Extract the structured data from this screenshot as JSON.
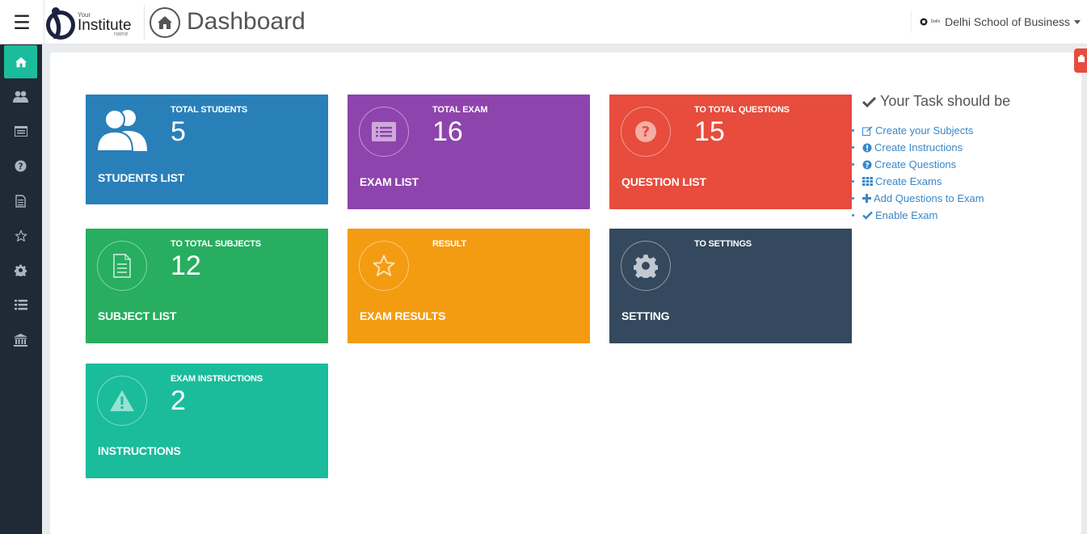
{
  "header": {
    "menu_icon": "hamburger-icon",
    "logo": {
      "your": "Your",
      "institute": "Institute",
      "name": "name"
    },
    "page_title": "Dashboard",
    "user": {
      "logo_text": "Delhi",
      "name": "Delhi School of Business"
    }
  },
  "sidebar": {
    "items": [
      {
        "icon": "home-icon",
        "active": true
      },
      {
        "icon": "users-icon"
      },
      {
        "icon": "list-alt-icon"
      },
      {
        "icon": "question-circle-icon"
      },
      {
        "icon": "file-text-icon"
      },
      {
        "icon": "star-icon"
      },
      {
        "icon": "gear-icon"
      },
      {
        "icon": "list-icon"
      },
      {
        "icon": "institution-icon"
      }
    ]
  },
  "tiles": [
    {
      "label": "TOTAL STUDENTS",
      "count": "5",
      "title": "STUDENTS LIST",
      "color": "#2980b9",
      "icon": "users-icon"
    },
    {
      "label": "TOTAL EXAM",
      "count": "16",
      "title": "EXAM LIST",
      "color": "#8e44ad",
      "icon": "list-alt-icon"
    },
    {
      "label": "TO TOTAL QUESTIONS",
      "count": "15",
      "title": "QUESTION LIST",
      "color": "#e74c3c",
      "icon": "question-circle-icon"
    },
    {
      "label": "TO TOTAL SUBJECTS",
      "count": "12",
      "title": "SUBJECT LIST",
      "color": "#27ae60",
      "icon": "file-text-icon"
    },
    {
      "label": "RESULT",
      "count": "",
      "title": "EXAM RESULTS",
      "color": "#f39c12",
      "icon": "star-icon"
    },
    {
      "label": "TO SETTINGS",
      "count": "",
      "title": "SETTING",
      "color": "#34495e",
      "icon": "gear-icon"
    },
    {
      "label": "EXAM INSTRUCTIONS",
      "count": "2",
      "title": "INSTRUCTIONS",
      "color": "#1abc9c",
      "icon": "warning-icon"
    }
  ],
  "tasks": {
    "heading": "Your Task should be",
    "items": [
      {
        "label": "Create your Subjects",
        "icon": "edit-icon"
      },
      {
        "label": "Create Instructions",
        "icon": "exclamation-circle-icon"
      },
      {
        "label": "Create Questions",
        "icon": "question-circle-icon"
      },
      {
        "label": "Create Exams",
        "icon": "grid-icon"
      },
      {
        "label": "Add Questions to Exam",
        "icon": "plus-icon"
      },
      {
        "label": "Enable Exam",
        "icon": "check-icon"
      }
    ]
  },
  "colors": {
    "sidebar": "#1e2a36",
    "accent": "#1abc9c",
    "link": "#3a87c8",
    "alert_tab": "#e74c3c"
  }
}
